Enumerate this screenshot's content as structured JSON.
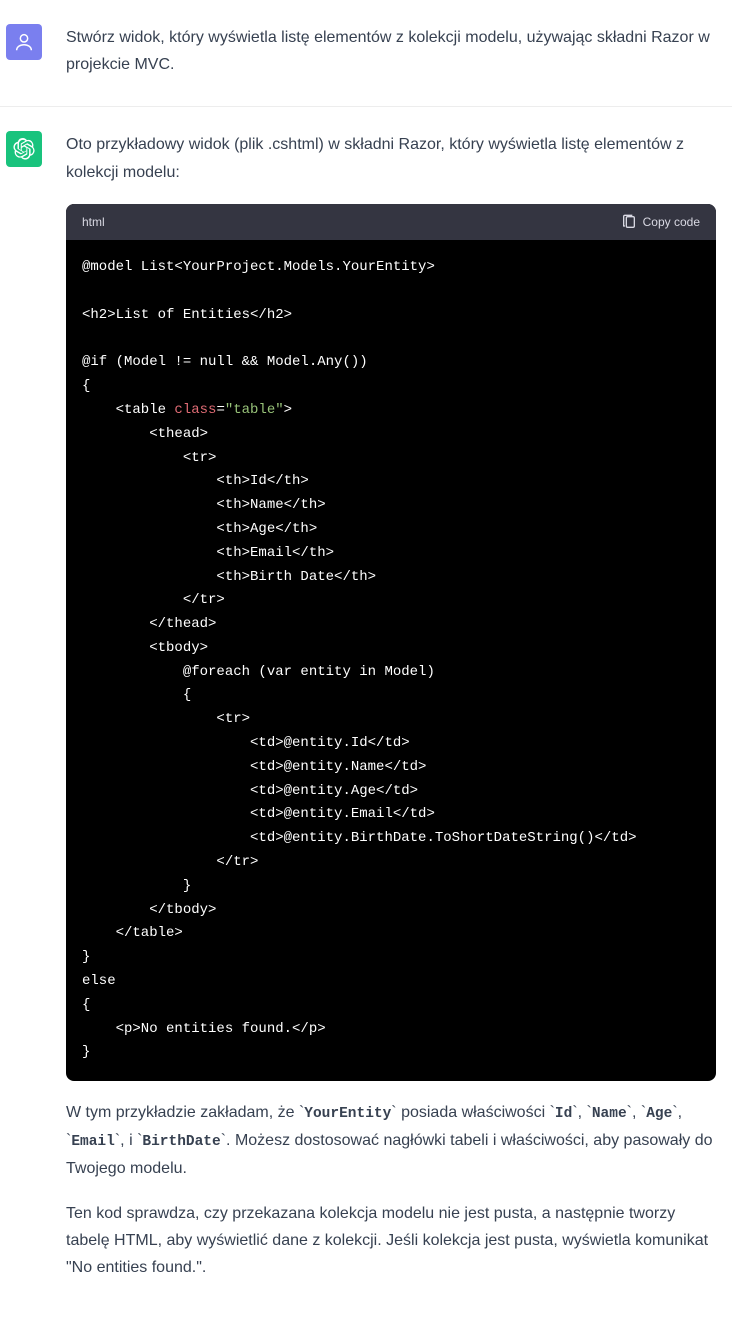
{
  "user": {
    "text": "Stwórz widok, który wyświetla listę elementów z kolekcji modelu, używając składni Razor w projekcie MVC."
  },
  "assistant": {
    "intro": "Oto przykładowy widok (plik .cshtml) w składni Razor, który wyświetla listę elementów z kolekcji modelu:",
    "code": {
      "lang": "html",
      "copy_label": "Copy code"
    },
    "para1_pre": "W tym przykładzie zakładam, że ",
    "c1": "YourEntity",
    "para1_mid1": " posiada właściwości ",
    "c2": "Id",
    "sep": ", ",
    "c3": "Name",
    "c4": "Age",
    "c5": "Email",
    "sep_and": ", i ",
    "c6": "BirthDate",
    "para1_post": ". Możesz dostosować nagłówki tabeli i właściwości, aby pasowały do Twojego modelu.",
    "para2": "Ten kod sprawdza, czy przekazana kolekcja modelu nie jest pusta, a następnie tworzy tabelę HTML, aby wyświetlić dane z kolekcji. Jeśli kolekcja jest pusta, wyświetla komunikat \"No entities found.\"."
  },
  "code_lines": {
    "l1": "@model List<YourProject.Models.YourEntity>",
    "l2": "<h2>List of Entities</h2>",
    "l3": "@if (Model != null && Model.Any())",
    "l4": "{",
    "l5a": "    <table ",
    "l5b": "class",
    "l5c": "=",
    "l5d": "\"table\"",
    "l5e": ">",
    "l6": "        <thead>",
    "l7": "            <tr>",
    "l8": "                <th>Id</th>",
    "l9": "                <th>Name</th>",
    "l10": "                <th>Age</th>",
    "l11": "                <th>Email</th>",
    "l12": "                <th>Birth Date</th>",
    "l13": "            </tr>",
    "l14": "        </thead>",
    "l15": "        <tbody>",
    "l16": "            @foreach (var entity in Model)",
    "l17": "            {",
    "l18": "                <tr>",
    "l19": "                    <td>@entity.Id</td>",
    "l20": "                    <td>@entity.Name</td>",
    "l21": "                    <td>@entity.Age</td>",
    "l22": "                    <td>@entity.Email</td>",
    "l23": "                    <td>@entity.BirthDate.ToShortDateString()</td>",
    "l24": "                </tr>",
    "l25": "            }",
    "l26": "        </tbody>",
    "l27": "    </table>",
    "l28": "}",
    "l29": "else",
    "l30": "{",
    "l31": "    <p>No entities found.</p>",
    "l32": "}"
  }
}
